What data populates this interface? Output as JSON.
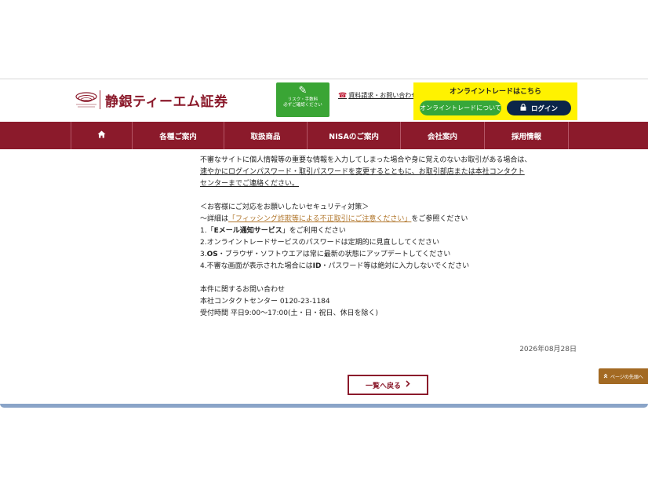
{
  "header": {
    "brand_name": "静銀ティーエム証券",
    "risk_button": {
      "line1": "リスク・手数料",
      "line2": "必ずご確認ください"
    },
    "inquiry_link": "資料請求・お問い合わせ",
    "online_trade": {
      "title": "オンライントレードはこちら",
      "about_button": "オンライントレードについて",
      "login_button": "ログイン"
    }
  },
  "nav": {
    "items": [
      {
        "label": "",
        "icon": "home-icon"
      },
      {
        "label": "各種ご案内"
      },
      {
        "label": "取扱商品"
      },
      {
        "label": "NISAのご案内"
      },
      {
        "label": "会社案内"
      },
      {
        "label": "採用情報"
      }
    ]
  },
  "content": {
    "line1": "不審なサイトに個人情報等の重要な情報を入力してしまった場合や身に覚えのないお取引がある場合は、",
    "line2": "速やかにログインパスワード・取引パスワードを変更するとともに、お取引部店または本社コンタクト",
    "line3": "センターまでご連絡ください。",
    "sec_title": "＜お客様にご対応をお願いしたいセキュリティ対策＞",
    "detail_prefix": "～詳細は",
    "detail_link": "「フィッシング詐欺等による不正取引にご注意ください」",
    "detail_suffix": "をご参照ください",
    "item1_a": "1.「",
    "item1_b": "Eメール通知サービス",
    "item1_c": "」をご利用ください",
    "item2": "2.オンライントレードサービスのパスワードは定期的に見直ししてください",
    "item3_a": "3.",
    "item3_b": "OS",
    "item3_c": "・ブラウザ・ソフトウエアは常に最新の状態にアップデートしてください",
    "item4_a": "4.不審な画面が表示された場合には",
    "item4_b": "ID",
    "item4_c": "・パスワード等は絶対に入力しないでください",
    "contact_title": "本件に関するお問い合わせ",
    "contact_center": "本社コンタクトセンター 0120-23-1184",
    "hours": "受付時間 平日9:00～17:00(土・日・祝日、休日を除く)"
  },
  "date": "2026年08月28日",
  "back_button": "一覧へ戻る",
  "to_top_button": "ページの先頭へ",
  "colors": {
    "brand": "#8b1a2b",
    "risk_green": "#3aa535",
    "trade_yellow": "#fff200",
    "login_navy": "#0b2549",
    "to_top": "#a36a23"
  }
}
